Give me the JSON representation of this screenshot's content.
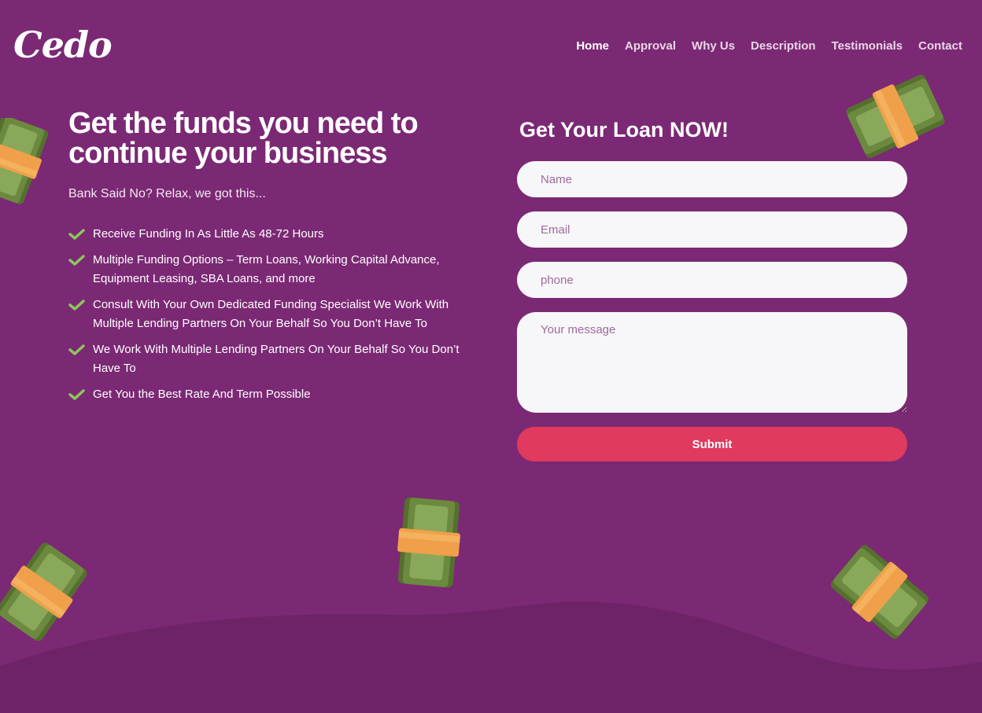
{
  "brand": {
    "logo": "Cedo"
  },
  "nav": {
    "items": [
      {
        "label": "Home",
        "active": true
      },
      {
        "label": "Approval",
        "active": false
      },
      {
        "label": "Why Us",
        "active": false
      },
      {
        "label": "Description",
        "active": false
      },
      {
        "label": "Testimonials",
        "active": false
      },
      {
        "label": "Contact",
        "active": false
      }
    ]
  },
  "hero": {
    "title": "Get the funds you need to continue your business",
    "subtitle": "Bank Said No? Relax, we got this...",
    "features": [
      "Receive Funding In As Little As 48-72 Hours",
      "Multiple Funding Options – Term Loans, Working Capital Advance, Equipment Leasing, SBA Loans, and more",
      "Consult With Your Own Dedicated Funding Specialist We Work With Multiple Lending Partners On Your Behalf So You Don’t Have To",
      "We Work With Multiple Lending Partners On Your Behalf So You Don’t Have To",
      "Get You the Best Rate And Term Possible"
    ]
  },
  "form": {
    "title": "Get Your Loan NOW!",
    "name_placeholder": "Name",
    "email_placeholder": "Email",
    "phone_placeholder": "phone",
    "message_placeholder": "Your message",
    "submit_label": "Submit"
  },
  "colors": {
    "background": "#7b2974",
    "wave": "#6e2368",
    "accent": "#e03a5f",
    "check": "#8fc65a",
    "cash_green": "#6c8a3f",
    "cash_band": "#f0a04a"
  },
  "decor": {
    "icon": "money-stack-icon"
  }
}
